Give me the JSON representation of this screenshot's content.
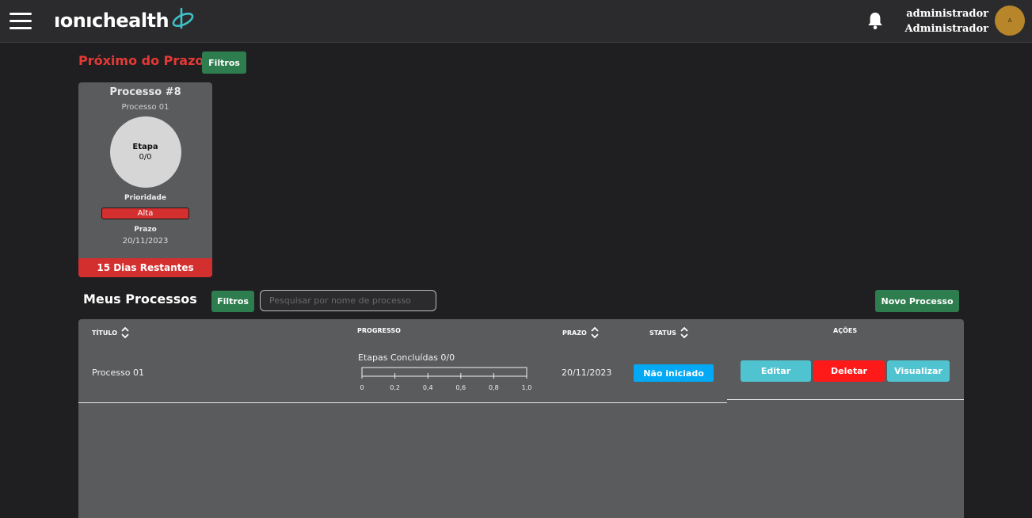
{
  "header": {
    "logo_text": "ıonıchealth",
    "user_name": "administrador",
    "user_role": "Administrador",
    "avatar_initial": "A"
  },
  "deadline_section": {
    "title": "Próximo do Prazo",
    "filter_label": "Filtros",
    "card": {
      "title": "Processo #8",
      "subtitle": "Processo 01",
      "stage_label": "Etapa",
      "stage_value": "0/0",
      "priority_label": "Prioridade",
      "priority_value": "Alta",
      "deadline_label": "Prazo",
      "deadline_value": "20/11/2023",
      "remaining": "15 Dias Restantes"
    }
  },
  "processes_section": {
    "title": "Meus Processos",
    "filter_label": "Filtros",
    "search_placeholder": "Pesquisar por nome de processo",
    "new_button": "Novo Processo",
    "columns": {
      "title": "TÍTULO",
      "progress": "PROGRESSO",
      "deadline": "PRAZO",
      "status": "STATUS",
      "actions": "AÇÕES"
    },
    "rows": [
      {
        "title": "Processo 01",
        "progress_label": "Etapas Concluídas 0/0",
        "progress_value": 0,
        "axis_ticks": [
          "0",
          "0,2",
          "0,4",
          "0,6",
          "0,8",
          "1,0"
        ],
        "deadline": "20/11/2023",
        "status": "Não iniciado",
        "actions": {
          "edit": "Editar",
          "delete": "Deletar",
          "view": "Visualizar"
        }
      }
    ]
  },
  "colors": {
    "accent_red": "#e53935",
    "button_green": "#2e7d4f",
    "status_blue": "#03a9f4",
    "edit_teal": "#4fc3cf",
    "delete_red": "#ff1a1a"
  }
}
